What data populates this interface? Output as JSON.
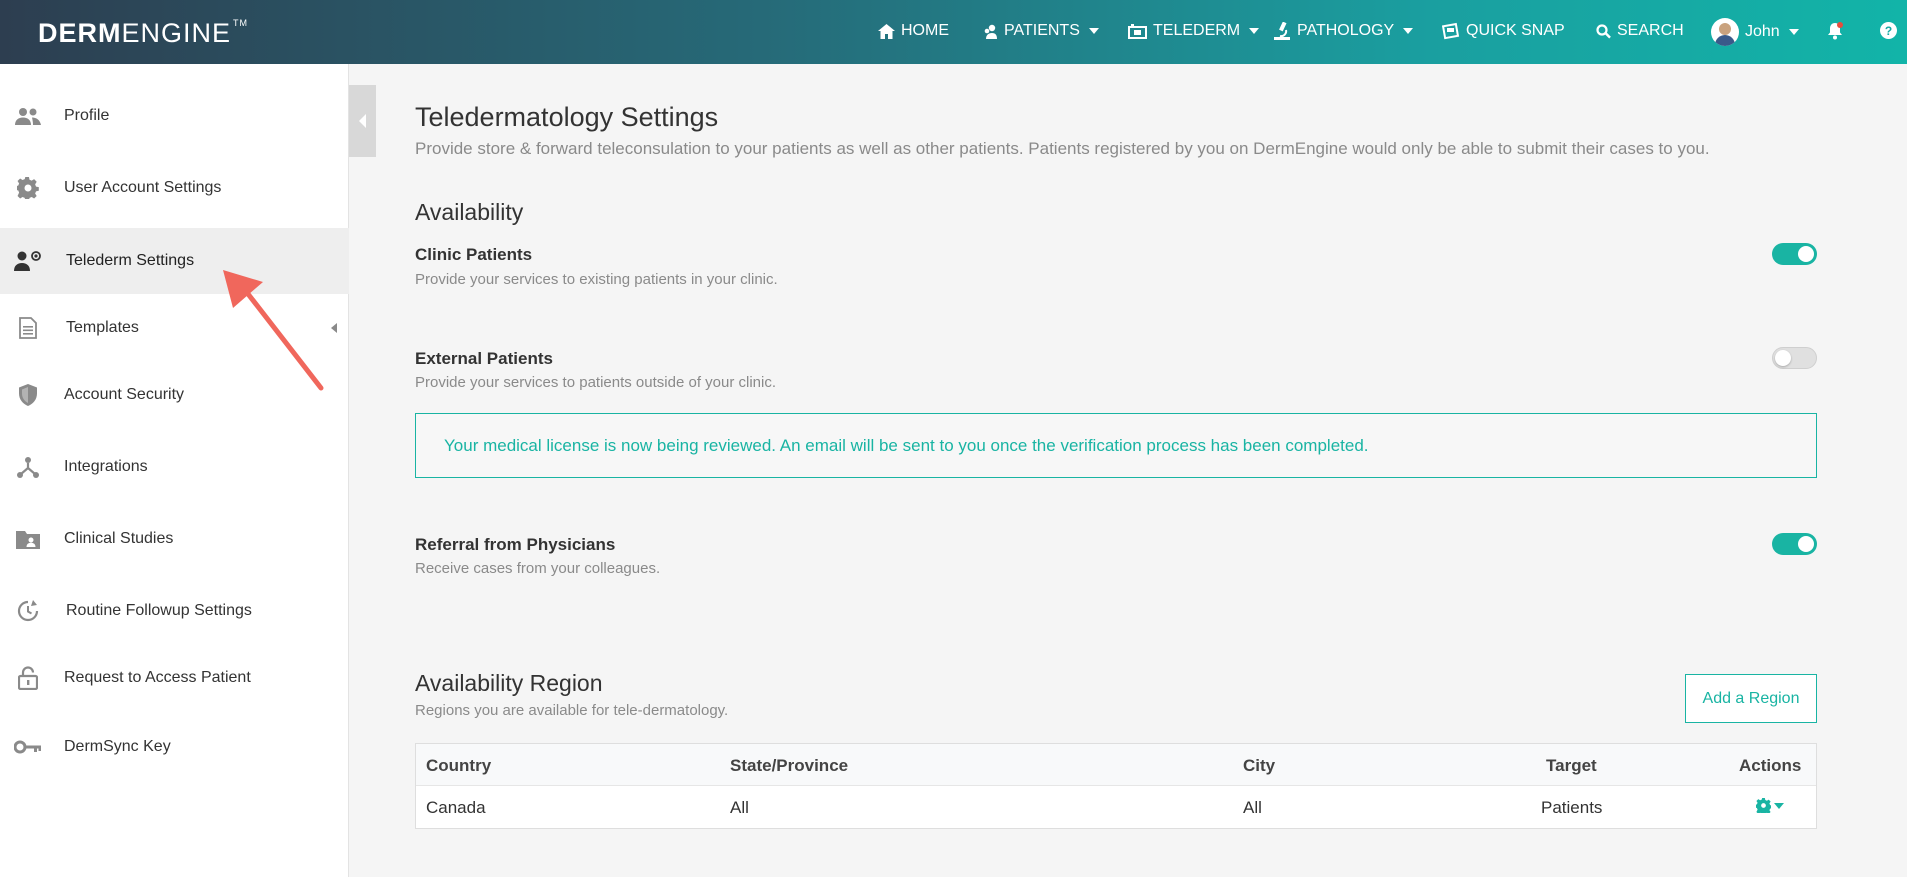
{
  "header": {
    "logo_bold": "DERM",
    "logo_light": "ENGINE",
    "logo_tm": "TM",
    "nav": {
      "home": "HOME",
      "patients": "PATIENTS",
      "telederm": "TELEDERM",
      "pathology": "PATHOLOGY",
      "quick_snap": "QUICK SNAP",
      "search": "SEARCH",
      "user": "John"
    },
    "colors": {
      "accent": "#19b4a3",
      "dark": "#2d3e50"
    }
  },
  "sidebar": {
    "items": [
      {
        "label": "Profile",
        "icon": "users-icon"
      },
      {
        "label": "User Account Settings",
        "icon": "gear-icon"
      },
      {
        "label": "Telederm Settings",
        "icon": "telederm-user-icon",
        "active": true
      },
      {
        "label": "Templates",
        "icon": "document-icon"
      },
      {
        "label": "Account Security",
        "icon": "shield-icon"
      },
      {
        "label": "Integrations",
        "icon": "integrations-icon"
      },
      {
        "label": "Clinical Studies",
        "icon": "folder-user-icon"
      },
      {
        "label": "Routine Followup Settings",
        "icon": "refresh-clock-icon"
      },
      {
        "label": "Request to Access Patient",
        "icon": "lock-icon"
      },
      {
        "label": "DermSync Key",
        "icon": "key-icon"
      }
    ]
  },
  "main": {
    "title": "Teledermatology Settings",
    "subtitle": "Provide store & forward teleconsulation to your patients as well as other patients. Patients registered by you on DermEngine would only be able to submit their cases to you.",
    "availability": {
      "heading": "Availability",
      "clinic": {
        "title": "Clinic Patients",
        "desc": "Provide your services to existing patients in your clinic.",
        "enabled": true
      },
      "external": {
        "title": "External Patients",
        "desc": "Provide your services to patients outside of your clinic.",
        "enabled": false
      },
      "alert": "Your medical license is now being reviewed. An email will be sent to you once the verification process has been completed.",
      "referral": {
        "title": "Referral from Physicians",
        "desc": "Receive cases from your colleagues.",
        "enabled": true
      }
    },
    "region": {
      "heading": "Availability Region",
      "desc": "Regions you are available for tele-dermatology.",
      "add_button": "Add a Region",
      "columns": [
        "Country",
        "State/Province",
        "City",
        "Target",
        "Actions"
      ],
      "rows": [
        {
          "country": "Canada",
          "state": "All",
          "city": "All",
          "target": "Patients"
        }
      ]
    }
  }
}
